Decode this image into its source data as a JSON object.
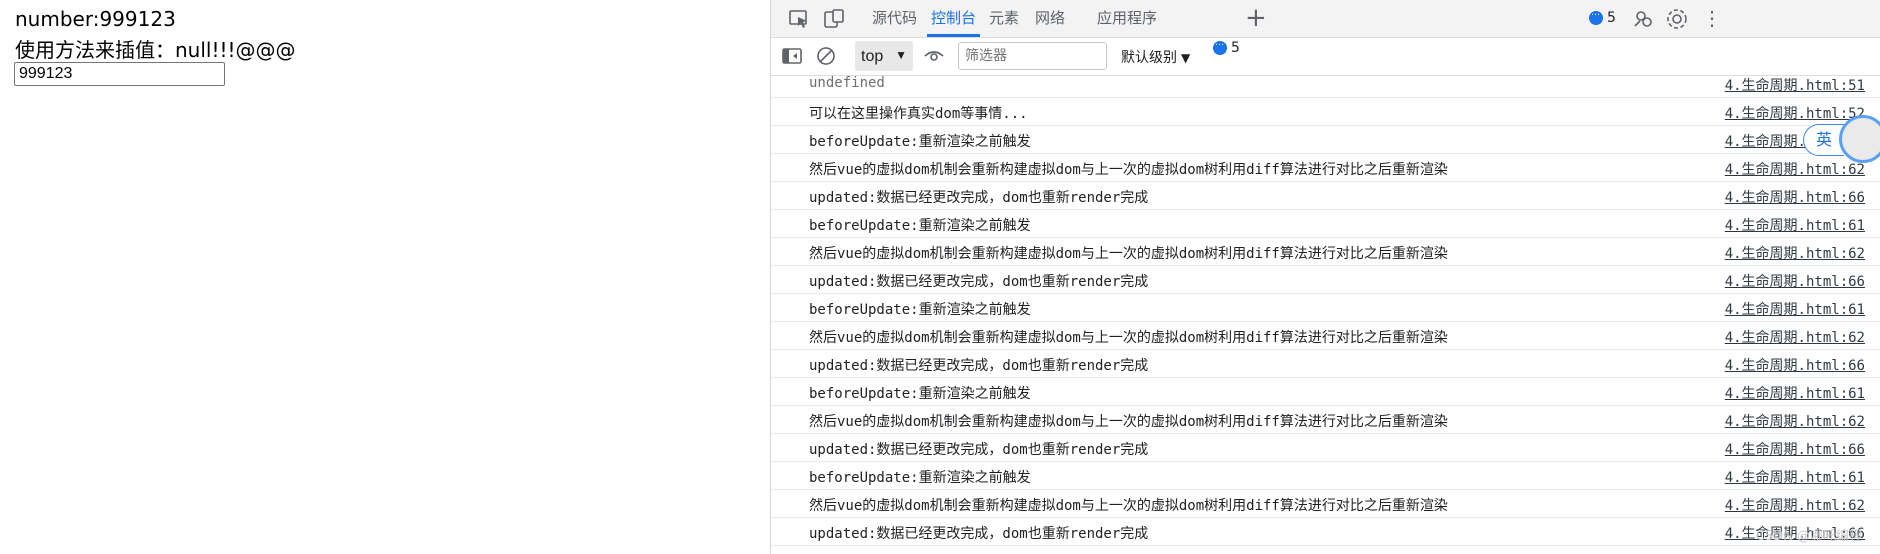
{
  "page": {
    "number_line": "number:999123",
    "interp_line": "使用方法来插值：null!!!@@@",
    "input_value": "999123"
  },
  "devtools": {
    "tabs": [
      "源代码",
      "控制台",
      "元素",
      "网络",
      "应用程序"
    ],
    "active_tab": "控制台",
    "issues_count": "5",
    "context": "top",
    "filter_placeholder": "筛选器",
    "levels": "默认级别",
    "toolbar_issues_count": "5",
    "icons": [
      "inspect-icon",
      "device-toggle-icon",
      "add-tab-icon",
      "issues-icon",
      "customize-icon",
      "settings-icon",
      "sidebar-toggle-icon",
      "clear-console-icon",
      "live-expression-icon"
    ],
    "accent": "#1a73e8"
  },
  "console": {
    "rows": [
      {
        "msg": "undefined",
        "src": "4.生命周期.html:51"
      },
      {
        "msg": "可以在这里操作真实dom等事情...",
        "src": "4.生命周期.html:52"
      },
      {
        "msg": "beforeUpdate:重新渲染之前触发",
        "src": "4.生命周期.html:61"
      },
      {
        "msg": "然后vue的虚拟dom机制会重新构建虚拟dom与上一次的虚拟dom树利用diff算法进行对比之后重新渲染",
        "src": "4.生命周期.html:62"
      },
      {
        "msg": "updated:数据已经更改完成，dom也重新render完成",
        "src": "4.生命周期.html:66"
      },
      {
        "msg": "beforeUpdate:重新渲染之前触发",
        "src": "4.生命周期.html:61"
      },
      {
        "msg": "然后vue的虚拟dom机制会重新构建虚拟dom与上一次的虚拟dom树利用diff算法进行对比之后重新渲染",
        "src": "4.生命周期.html:62"
      },
      {
        "msg": "updated:数据已经更改完成，dom也重新render完成",
        "src": "4.生命周期.html:66"
      },
      {
        "msg": "beforeUpdate:重新渲染之前触发",
        "src": "4.生命周期.html:61"
      },
      {
        "msg": "然后vue的虚拟dom机制会重新构建虚拟dom与上一次的虚拟dom树利用diff算法进行对比之后重新渲染",
        "src": "4.生命周期.html:62"
      },
      {
        "msg": "updated:数据已经更改完成，dom也重新render完成",
        "src": "4.生命周期.html:66"
      },
      {
        "msg": "beforeUpdate:重新渲染之前触发",
        "src": "4.生命周期.html:61"
      },
      {
        "msg": "然后vue的虚拟dom机制会重新构建虚拟dom与上一次的虚拟dom树利用diff算法进行对比之后重新渲染",
        "src": "4.生命周期.html:62"
      },
      {
        "msg": "updated:数据已经更改完成，dom也重新render完成",
        "src": "4.生命周期.html:66"
      },
      {
        "msg": "beforeUpdate:重新渲染之前触发",
        "src": "4.生命周期.html:61"
      },
      {
        "msg": "然后vue的虚拟dom机制会重新构建虚拟dom与上一次的虚拟dom树利用diff算法进行对比之后重新渲染",
        "src": "4.生命周期.html:62"
      },
      {
        "msg": "updated:数据已经更改完成，dom也重新render完成",
        "src": "4.生命周期.html:66"
      }
    ]
  },
  "overlay": {
    "ime_label": "英",
    "watermark": "CSDN @哪吒编程"
  }
}
